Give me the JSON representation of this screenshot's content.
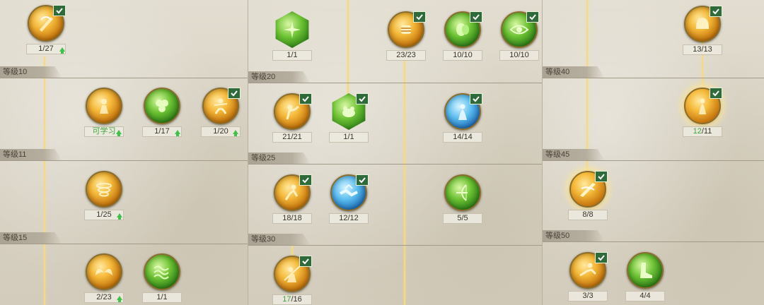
{
  "colors": {
    "accent_gold": "#f5b93a",
    "accent_green": "#6cc233",
    "accent_blue": "#5cbdf0",
    "learned_check": "#2f6b3a",
    "highlight_text": "#3fa43f"
  },
  "panels": [
    {
      "levels": [
        "等级10",
        "等级11",
        "等级15"
      ],
      "nodes": [
        {
          "icon": "flame-sword-icon",
          "count": "1/27",
          "upgrade": true,
          "learned": true
        },
        {
          "icon": "warrior-icon",
          "count": "可学习",
          "upgrade": true,
          "learned": false
        },
        {
          "icon": "clover-icon",
          "count": "1/17",
          "upgrade": true,
          "learned": false
        },
        {
          "icon": "dancer-icon",
          "count": "1/20",
          "upgrade": true,
          "learned": true
        },
        {
          "icon": "whirlwind-icon",
          "count": "1/25",
          "upgrade": true,
          "learned": false
        },
        {
          "icon": "golden-wings-icon",
          "count": "2/23",
          "upgrade": true,
          "learned": false
        },
        {
          "icon": "green-chain-icon",
          "count": "1/1",
          "upgrade": false,
          "learned": false
        }
      ]
    },
    {
      "levels": [
        "等级20",
        "等级25",
        "等级30"
      ],
      "nodes": [
        {
          "icon": "green-burst-icon",
          "count": "1/1",
          "learned": false
        },
        {
          "icon": "fist-icon",
          "count": "23/23",
          "learned": true
        },
        {
          "icon": "green-orb-icon",
          "count": "10/10",
          "learned": true
        },
        {
          "icon": "eye-icon",
          "count": "10/10",
          "learned": true
        },
        {
          "icon": "charge-icon",
          "count": "21/21",
          "learned": true
        },
        {
          "icon": "frog-icon",
          "count": "1/1",
          "learned": true
        },
        {
          "icon": "ice-maiden-icon",
          "count": "14/14",
          "learned": true
        },
        {
          "icon": "leaping-warrior-icon",
          "count": "18/18",
          "learned": true
        },
        {
          "icon": "handshake-icon",
          "count": "12/12",
          "learned": true
        },
        {
          "icon": "archer-icon",
          "count": "5/5",
          "learned": false
        },
        {
          "icon": "spear-warrior-icon",
          "count_current": "17",
          "count_max": "/16",
          "learned": true
        }
      ]
    },
    {
      "levels": [
        "等级40",
        "等级45",
        "等级50"
      ],
      "nodes": [
        {
          "icon": "golden-helm-icon",
          "count": "13/13",
          "learned": true
        },
        {
          "icon": "golden-dancer-icon",
          "count_current": "12",
          "count_max": "/11",
          "learned": true
        },
        {
          "icon": "golden-blade-icon",
          "count": "8/8",
          "learned": true
        },
        {
          "icon": "golden-dash-icon",
          "count": "3/3",
          "learned": true
        },
        {
          "icon": "green-boot-icon",
          "count": "4/4",
          "learned": false
        }
      ]
    }
  ]
}
